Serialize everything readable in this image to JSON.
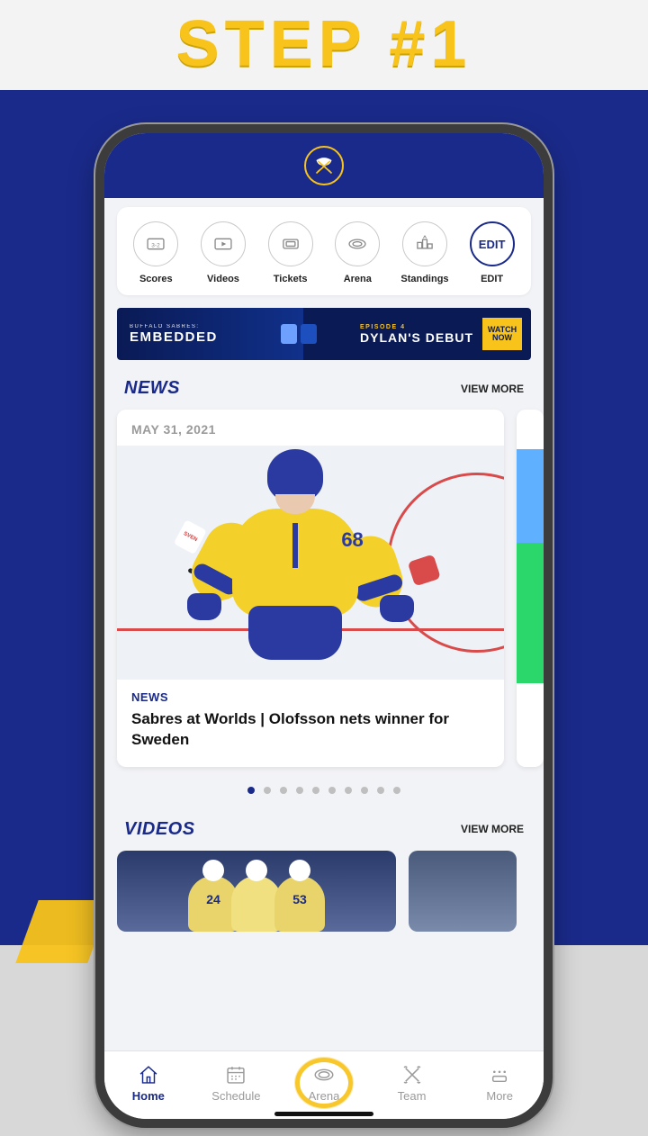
{
  "page": {
    "step_title": "STEP #1"
  },
  "quicknav": {
    "items": [
      {
        "label": "Scores"
      },
      {
        "label": "Videos"
      },
      {
        "label": "Tickets"
      },
      {
        "label": "Arena"
      },
      {
        "label": "Standings"
      },
      {
        "label": "EDIT"
      }
    ],
    "edit_text": "EDIT"
  },
  "banner": {
    "subline": "BUFFALO SABRES:",
    "title": "EMBEDDED",
    "episode_label": "EPISODE 4",
    "episode_title": "DYLAN'S DEBUT",
    "watch1": "WATCH",
    "watch2": "NOW"
  },
  "news": {
    "section_title": "NEWS",
    "view_more": "VIEW MORE",
    "cards": [
      {
        "date": "MAY 31, 2021",
        "tag": "NEWS",
        "headline": "Sabres at Worlds | Olofsson nets winner for Sweden",
        "jersey_number": "68"
      }
    ],
    "dot_count": 10,
    "active_dot": 0
  },
  "videos": {
    "section_title": "VIDEOS",
    "view_more": "VIEW MORE",
    "jerseys": [
      "24",
      "",
      "53"
    ]
  },
  "tabs": {
    "items": [
      {
        "label": "Home",
        "active": true
      },
      {
        "label": "Schedule",
        "active": false
      },
      {
        "label": "Arena",
        "active": false
      },
      {
        "label": "Team",
        "active": false
      },
      {
        "label": "More",
        "active": false
      }
    ]
  }
}
